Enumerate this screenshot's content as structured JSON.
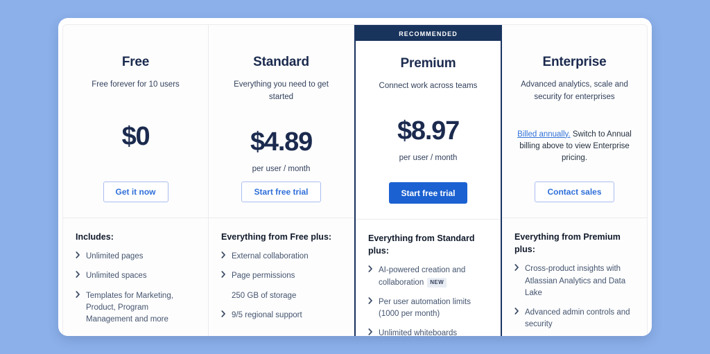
{
  "theme": {
    "page_background": "#8CB0EA",
    "card_background": "#ffffff",
    "brand_navy": "#1b2a4e",
    "badge_navy": "#18335c",
    "primary_blue": "#1b61d1",
    "link_blue": "#3272d9",
    "muted_text": "#44546f"
  },
  "plans": [
    {
      "name": "Free",
      "tagline": "Free forever for 10 users",
      "price": "$0",
      "period": "",
      "badge": "",
      "recommended": false,
      "cta": {
        "label": "Get it now",
        "style": "outline"
      },
      "features_title": "Includes:",
      "features": [
        {
          "text": "Unlimited pages",
          "chevron": true,
          "badge": ""
        },
        {
          "text": "Unlimited spaces",
          "chevron": true,
          "badge": ""
        },
        {
          "text": "Templates for Marketing, Product, Program Management and more",
          "chevron": true,
          "badge": ""
        }
      ]
    },
    {
      "name": "Standard",
      "tagline": "Everything you need to get started",
      "price": "$4.89",
      "period": "per user / month",
      "badge": "",
      "recommended": false,
      "cta": {
        "label": "Start free trial",
        "style": "outline"
      },
      "features_title": "Everything from Free plus:",
      "features": [
        {
          "text": "External collaboration",
          "chevron": true,
          "badge": ""
        },
        {
          "text": "Page permissions",
          "chevron": true,
          "badge": ""
        },
        {
          "text": "250 GB of storage",
          "chevron": false,
          "badge": ""
        },
        {
          "text": "9/5 regional support",
          "chevron": true,
          "badge": ""
        }
      ]
    },
    {
      "name": "Premium",
      "tagline": "Connect work across teams",
      "price": "$8.97",
      "period": "per user / month",
      "badge": "RECOMMENDED",
      "recommended": true,
      "cta": {
        "label": "Start free trial",
        "style": "primary"
      },
      "features_title": "Everything from Standard plus:",
      "features": [
        {
          "text": "AI-powered creation and collaboration",
          "chevron": true,
          "badge": "NEW"
        },
        {
          "text": "Per user automation limits (1000 per month)",
          "chevron": true,
          "badge": ""
        },
        {
          "text": "Unlimited whiteboards",
          "chevron": true,
          "badge": ""
        }
      ]
    },
    {
      "name": "Enterprise",
      "tagline": "Advanced analytics, scale and security for enterprises",
      "price": "",
      "period": "",
      "badge": "",
      "recommended": false,
      "billing_note": {
        "link_text": "Billed annually.",
        "rest_text": " Switch to Annual billing above to view Enterprise pricing."
      },
      "cta": {
        "label": "Contact sales",
        "style": "outline"
      },
      "features_title": "Everything from Premium plus:",
      "features": [
        {
          "text": "Cross-product insights with Atlassian Analytics and Data Lake",
          "chevron": true,
          "badge": ""
        },
        {
          "text": "Advanced admin controls and security",
          "chevron": true,
          "badge": ""
        }
      ]
    }
  ]
}
